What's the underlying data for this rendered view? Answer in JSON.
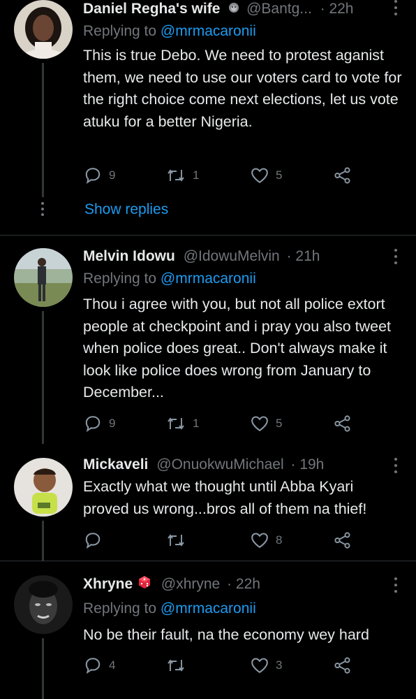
{
  "tweets": [
    {
      "name": "Daniel Regha's wife",
      "badge": "gorilla-emoji",
      "handle": "@Bantg...",
      "time": "· 22h",
      "replying_label": "Replying to",
      "replying_to": "@mrmacaronii",
      "text": "This is true Debo. We need to protest aganist them, we need to use our voters card to vote for the right choice come next elections, let us vote atuku for a better Nigeria.",
      "replies": "9",
      "retweets": "1",
      "likes": "5",
      "show_replies": "Show replies"
    },
    {
      "name": "Melvin Idowu",
      "handle": "@IdowuMelvin",
      "time": "· 21h",
      "replying_label": "Replying to",
      "replying_to": "@mrmacaronii",
      "text": "Thou i agree with you, but not all police extort people at checkpoint and i pray you also tweet when police does great.. Don't always make it look like police does wrong from January to December...",
      "replies": "9",
      "retweets": "1",
      "likes": "5"
    },
    {
      "name": "Mickaveli",
      "handle": "@OnuokwuMichael",
      "time": "· 19h",
      "text": "Exactly what we thought until Abba Kyari proved us wrong...bros all of them na thief!",
      "replies": "",
      "retweets": "",
      "likes": "8"
    },
    {
      "name": "Xhryne",
      "badge": "game-die-emoji",
      "handle": "@xhryne",
      "time": "· 22h",
      "replying_label": "Replying to",
      "replying_to": "@mrmacaronii",
      "text": "No be their fault, na the economy wey hard",
      "replies": "4",
      "retweets": "",
      "likes": "3"
    }
  ],
  "colors": {
    "background": "#000000",
    "text": "#e7e9ea",
    "secondary": "#71767b",
    "link": "#1d9bf0",
    "divider": "#2f3336"
  }
}
